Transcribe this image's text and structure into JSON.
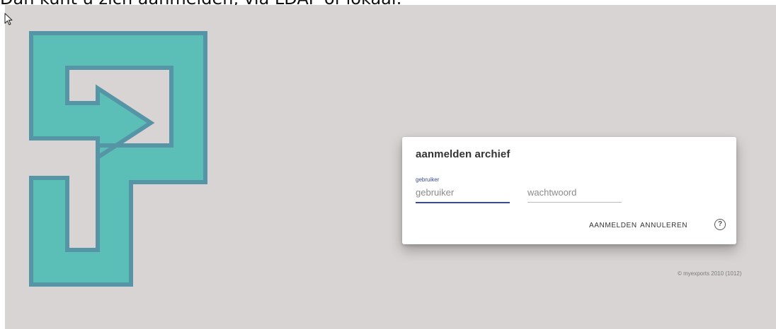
{
  "caption": "Dan kunt u zich aanmelden, via LDAP of lokaal:",
  "dialog": {
    "title": "aanmelden archief",
    "user_label": "gebruiker",
    "user_placeholder": "gebruiker",
    "password_placeholder": "wachtwoord",
    "login_label": "AANMELDEN",
    "cancel_label": "ANNULEREN",
    "help_icon": "help-circle-icon",
    "help_glyph": "?"
  },
  "footer": {
    "copyright": "© myexports 2010 (1012)"
  },
  "colors": {
    "background": "#d9d4d4",
    "logo_fill": "#5bbfb7",
    "logo_stroke": "#5595a5",
    "accent": "#3b4a8c"
  }
}
